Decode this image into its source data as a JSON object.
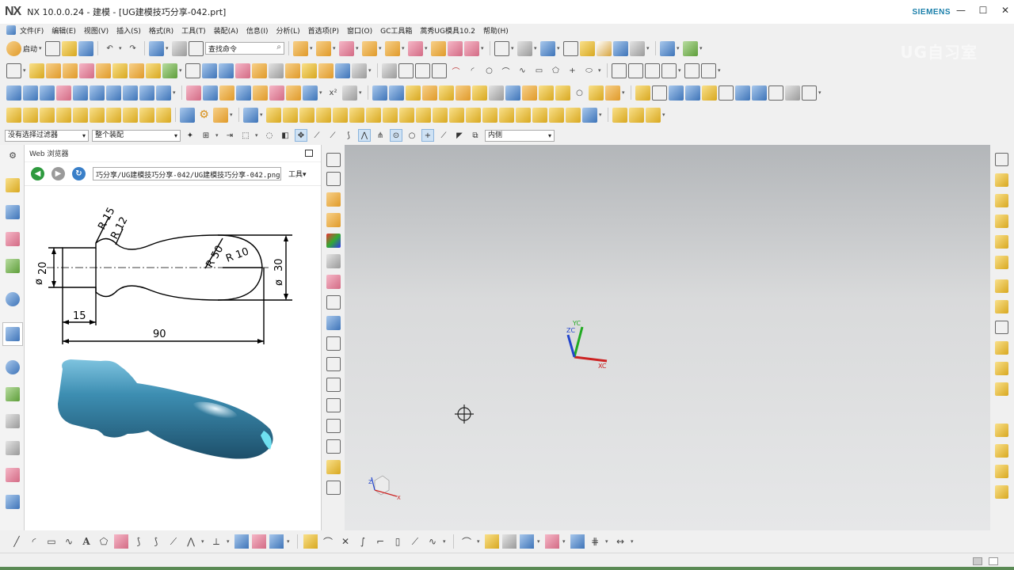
{
  "window": {
    "logo": "NX",
    "title": "NX 10.0.0.24 - 建模 - [UG建模技巧分享-042.prt]",
    "brand": "SIEMENS",
    "minimize": "—",
    "restore": "☐",
    "close": "✕"
  },
  "menubar": {
    "items": [
      "文件(F)",
      "编辑(E)",
      "视图(V)",
      "插入(S)",
      "格式(R)",
      "工具(T)",
      "装配(A)",
      "信息(I)",
      "分析(L)",
      "首选项(P)",
      "窗口(O)",
      "GC工具箱",
      "蒿秀UG模具10.2",
      "帮助(H)"
    ]
  },
  "toolbar": {
    "start_label": "启动",
    "command_search_placeholder": "查找命令",
    "watermark": "UG自习室"
  },
  "filterbar": {
    "type_filter": "没有选择过滤器",
    "scope": "整个装配",
    "face_rule": "内侧"
  },
  "web_browser": {
    "title": "Web 浏览器",
    "url": "巧分享/UG建模技巧分享-042/UG建模技巧分享-042.png",
    "tools_label": "工具"
  },
  "drawing": {
    "dims": {
      "r15": "R 15",
      "r12": "R 12",
      "r50": "R 50",
      "r10": "R 10",
      "d20": "20",
      "d30": "30",
      "len15": "15",
      "len90": "90",
      "dia": "ø"
    }
  },
  "viewport": {
    "axis_x": "XC",
    "axis_y": "YC",
    "axis_z": "ZC",
    "mini_x": "X",
    "mini_y": "Y",
    "mini_z": "Z"
  },
  "colors": {
    "accent": "#1a7faa",
    "part_blue": "#3d86a8",
    "axis_x": "#cc2222",
    "axis_y": "#22aa22",
    "axis_z": "#2244cc"
  }
}
